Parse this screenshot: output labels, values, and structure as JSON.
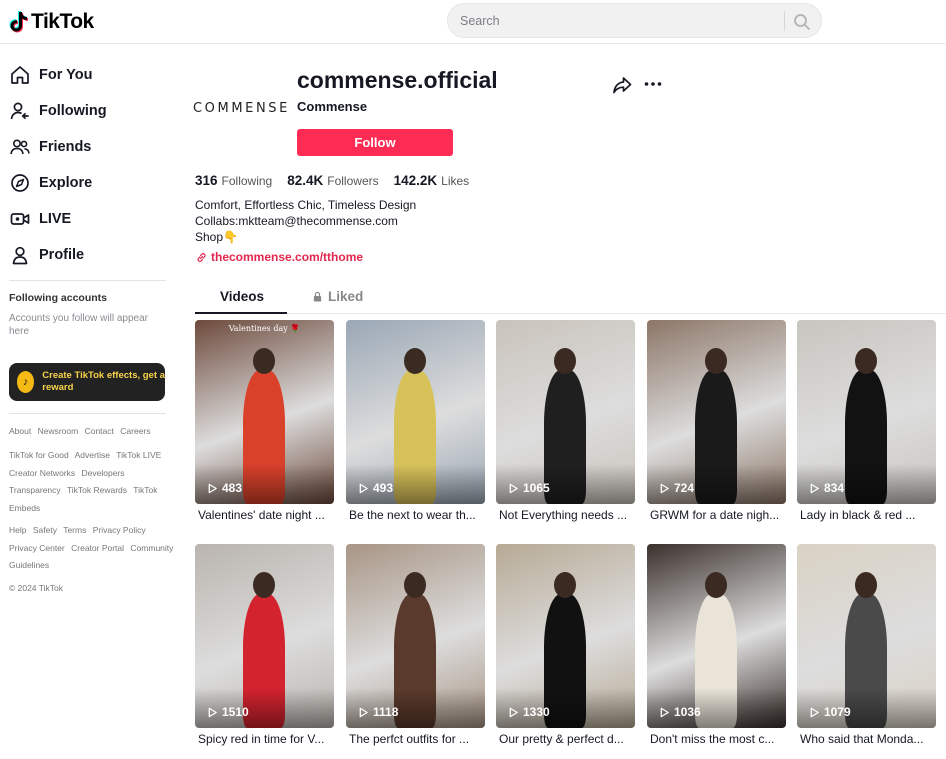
{
  "header": {
    "logo_text": "TikTok",
    "search_placeholder": "Search"
  },
  "sidebar": {
    "nav": [
      {
        "label": "For You",
        "icon": "home-icon"
      },
      {
        "label": "Following",
        "icon": "user-follow-icon"
      },
      {
        "label": "Friends",
        "icon": "friends-icon"
      },
      {
        "label": "Explore",
        "icon": "compass-icon"
      },
      {
        "label": "LIVE",
        "icon": "live-icon"
      },
      {
        "label": "Profile",
        "icon": "profile-icon"
      }
    ],
    "following_accounts_title": "Following accounts",
    "following_accounts_desc": "Accounts you follow will appear here",
    "effects_banner": "Create TikTok effects, get a reward",
    "footer_groups": [
      [
        "About",
        "Newsroom",
        "Contact",
        "Careers"
      ],
      [
        "TikTok for Good",
        "Advertise",
        "TikTok LIVE Creator Networks",
        "Developers",
        "Transparency",
        "TikTok Rewards",
        "TikTok Embeds"
      ],
      [
        "Help",
        "Safety",
        "Terms",
        "Privacy Policy",
        "Privacy Center",
        "Creator Portal",
        "Community Guidelines"
      ],
      [
        "© 2024 TikTok"
      ]
    ]
  },
  "profile": {
    "avatar_text": "COMMENSE",
    "username": "commense.official",
    "nickname": "Commense",
    "follow_label": "Follow",
    "stats": {
      "following_count": "316",
      "following_label": "Following",
      "followers_count": "82.4K",
      "followers_label": "Followers",
      "likes_count": "142.2K",
      "likes_label": "Likes"
    },
    "bio": [
      "Comfort, Effortless Chic, Timeless Design",
      "Collabs:mktteam@thecommense.com",
      "Shop👇"
    ],
    "link": "thecommense.com/tthome"
  },
  "tabs": {
    "videos": "Videos",
    "liked": "Liked"
  },
  "videos": [
    {
      "views": "483",
      "caption": "Valentines' date night ...",
      "overlay": "Valentines day 🌹",
      "bg": "#6d4a3c",
      "accent": "#d9412b"
    },
    {
      "views": "493",
      "caption": "Be the next to wear th...",
      "overlay": "",
      "bg": "#9aa7b5",
      "accent": "#d7c25a"
    },
    {
      "views": "1065",
      "caption": "Not Everything needs ...",
      "overlay": "",
      "bg": "#c9c3bb",
      "accent": "#1f1f1f"
    },
    {
      "views": "724",
      "caption": "GRWM for a date nigh...",
      "overlay": "",
      "bg": "#8c7667",
      "accent": "#1a1a1a"
    },
    {
      "views": "834",
      "caption": "Lady in black & red ...",
      "overlay": "",
      "bg": "#c8c5bf",
      "accent": "#121212"
    },
    {
      "views": "1510",
      "caption": "Spicy red in time for V...",
      "overlay": "",
      "bg": "#b9b4ae",
      "accent": "#d3232e"
    },
    {
      "views": "1118",
      "caption": "The perfct outfits for ...",
      "overlay": "",
      "bg": "#a89585",
      "accent": "#5a3a2c"
    },
    {
      "views": "1330",
      "caption": "Our pretty & perfect d...",
      "overlay": "",
      "bg": "#b7aa95",
      "accent": "#111111"
    },
    {
      "views": "1036",
      "caption": "Don't miss the most c...",
      "overlay": "",
      "bg": "#3a302c",
      "accent": "#e9e3d8"
    },
    {
      "views": "1079",
      "caption": "Who said that Monda...",
      "overlay": "",
      "bg": "#d9d2c4",
      "accent": "#4a4a4a"
    }
  ]
}
